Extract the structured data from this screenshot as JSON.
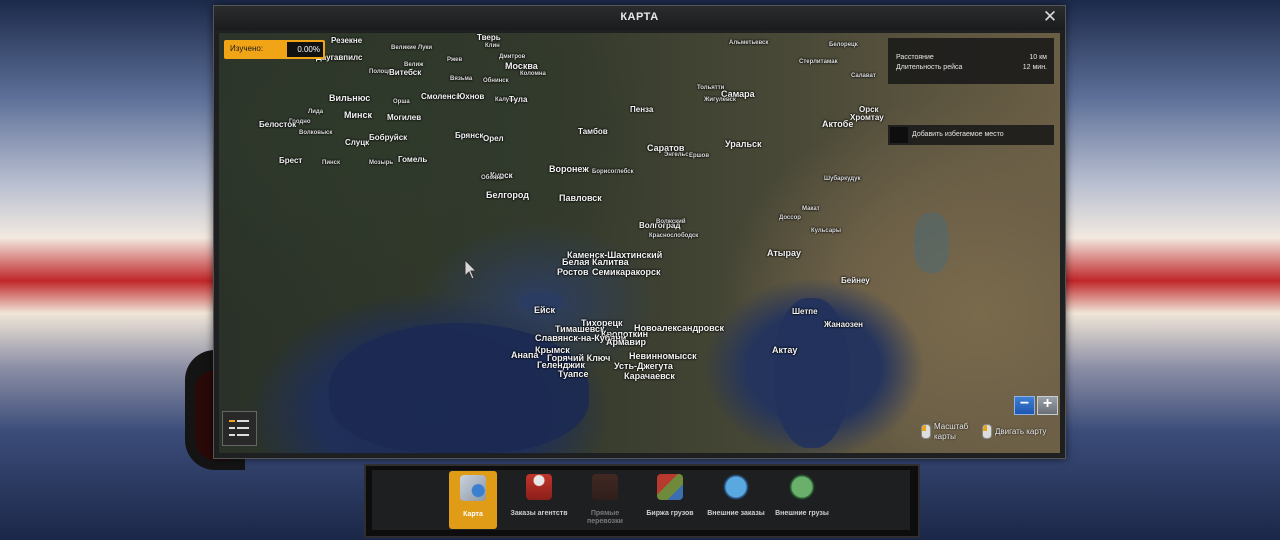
{
  "window": {
    "title": "КАРТА"
  },
  "explored": {
    "label": "Изучено:",
    "value": "0.00%"
  },
  "route_info": {
    "rows": [
      {
        "label": "Расстояние",
        "value": "10 км"
      },
      {
        "label": "Длительность рейса",
        "value": "12 мин."
      }
    ]
  },
  "avoid": {
    "label": "Добавить избегаемое место"
  },
  "controls": {
    "zoom_label": "Масштаб карты",
    "move_label": "Двигать карту"
  },
  "cities": [
    "Резекне",
    "Тверь",
    "Великие Луки",
    "Клин",
    "Даугавпилс",
    "Ржев",
    "Дмитров",
    "Полоцк",
    "Велиж",
    "Москва",
    "Витебск",
    "Вязьма",
    "Обнинск",
    "Коломна",
    "Смоленск",
    "Вильнюс",
    "Орша",
    "Калуга",
    "Юхнов",
    "Тула",
    "Минск",
    "Могилев",
    "Лида",
    "Гродно",
    "Бобруйск",
    "Волковыск",
    "Брянск",
    "Слуцк",
    "Белосток",
    "Орел",
    "Тамбов",
    "Брест",
    "Пинск",
    "Мозырь",
    "Гомель",
    "Воронеж",
    "Курск",
    "Борисоглебск",
    "Обоянь",
    "Белгород",
    "Павловск",
    "Пенза",
    "Самара",
    "Тольятти",
    "Жигулевск",
    "Альметьевск",
    "Белорецк",
    "Стерлитамак",
    "Салават",
    "Саратов",
    "Энгельс",
    "Ершов",
    "Уральск",
    "Актобе",
    "Орск",
    "Хромтау",
    "Волгоград",
    "Волжский",
    "Краснослободск",
    "Каменск-Шахтинский",
    "Белая Калитва",
    "Ростов",
    "Семикаракорск",
    "Атырау",
    "Бейнеу",
    "Кульсары",
    "Доссор",
    "Макат",
    "Шубаркудук",
    "Ейск",
    "Тихорецк",
    "Новоалександровск",
    "Тимашевск",
    "Кропоткин",
    "Славянск-на-Кубани",
    "Армавир",
    "Крымск",
    "Невинномысск",
    "Анапа",
    "Горячий Ключ",
    "Геленджик",
    "Усть-Джегута",
    "Туапсе",
    "Карачаевск",
    "Шетпе",
    "Жанаозен",
    "Актау"
  ],
  "dock": {
    "tabs": [
      {
        "label": "Карта"
      },
      {
        "label": "Заказы агентств"
      },
      {
        "label": "Прямые перевозки"
      },
      {
        "label": "Биржа грузов"
      },
      {
        "label": "Внешние заказы"
      },
      {
        "label": "Внешние грузы"
      }
    ]
  },
  "colors": {
    "accent": "#f0a416",
    "zoom_minus": "#2d6ac4"
  }
}
